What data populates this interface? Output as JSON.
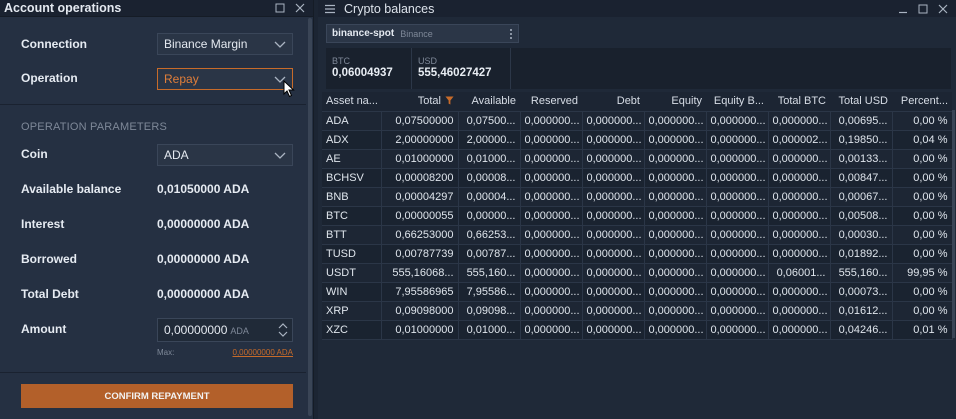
{
  "left_panel": {
    "title": "Account operations",
    "connection_label": "Connection",
    "connection_value": "Binance Margin",
    "operation_label": "Operation",
    "operation_value": "Repay",
    "section_title": "OPERATION PARAMETERS",
    "coin_label": "Coin",
    "coin_value": "ADA",
    "available_label": "Available balance",
    "available_value": "0,01050000 ADA",
    "interest_label": "Interest",
    "interest_value": "0,00000000 ADA",
    "borrowed_label": "Borrowed",
    "borrowed_value": "0,00000000 ADA",
    "total_debt_label": "Total Debt",
    "total_debt_value": "0,00000000 ADA",
    "amount_label": "Amount",
    "amount_value": "0,00000000",
    "amount_unit": "ADA",
    "max_label": "Max:",
    "max_value": "0,00000000 ADA",
    "confirm_label": "CONFIRM REPAYMENT"
  },
  "right_panel": {
    "title": "Crypto balances",
    "account_name": "binance-spot",
    "account_exchange": "Binance",
    "balances": [
      {
        "currency": "BTC",
        "value": "0,06004937"
      },
      {
        "currency": "USD",
        "value": "555,46027427"
      }
    ],
    "columns": [
      "Asset na...",
      "Total",
      "Available",
      "Reserved",
      "Debt",
      "Equity",
      "Equity B...",
      "Total BTC",
      "Total USD",
      "Percent..."
    ],
    "rows": [
      [
        "ADA",
        "0,07500000",
        "0,07500...",
        "0,000000...",
        "0,000000...",
        "0,000000...",
        "0,000000...",
        "0,000000...",
        "0,00695...",
        "0,00 %"
      ],
      [
        "ADX",
        "2,00000000",
        "2,00000...",
        "0,000000...",
        "0,000000...",
        "0,000000...",
        "0,000000...",
        "0,000002...",
        "0,19850...",
        "0,04 %"
      ],
      [
        "AE",
        "0,01000000",
        "0,01000...",
        "0,000000...",
        "0,000000...",
        "0,000000...",
        "0,000000...",
        "0,000000...",
        "0,00133...",
        "0,00 %"
      ],
      [
        "BCHSV",
        "0,00008200",
        "0,00008...",
        "0,000000...",
        "0,000000...",
        "0,000000...",
        "0,000000...",
        "0,000000...",
        "0,00847...",
        "0,00 %"
      ],
      [
        "BNB",
        "0,00004297",
        "0,00004...",
        "0,000000...",
        "0,000000...",
        "0,000000...",
        "0,000000...",
        "0,000000...",
        "0,00067...",
        "0,00 %"
      ],
      [
        "BTC",
        "0,00000055",
        "0,00000...",
        "0,000000...",
        "0,000000...",
        "0,000000...",
        "0,000000...",
        "0,000000...",
        "0,00508...",
        "0,00 %"
      ],
      [
        "BTT",
        "0,66253000",
        "0,66253...",
        "0,000000...",
        "0,000000...",
        "0,000000...",
        "0,000000...",
        "0,000000...",
        "0,00030...",
        "0,00 %"
      ],
      [
        "TUSD",
        "0,00787739",
        "0,00787...",
        "0,000000...",
        "0,000000...",
        "0,000000...",
        "0,000000...",
        "0,000000...",
        "0,01892...",
        "0,00 %"
      ],
      [
        "USDT",
        "555,16068...",
        "555,160...",
        "0,000000...",
        "0,000000...",
        "0,000000...",
        "0,000000...",
        "0,06001...",
        "555,160...",
        "99,95 %"
      ],
      [
        "WIN",
        "7,95586965",
        "7,95586...",
        "0,000000...",
        "0,000000...",
        "0,000000...",
        "0,000000...",
        "0,000000...",
        "0,00073...",
        "0,00 %"
      ],
      [
        "XRP",
        "0,09098000",
        "0,09098...",
        "0,000000...",
        "0,000000...",
        "0,000000...",
        "0,000000...",
        "0,000000...",
        "0,01612...",
        "0,00 %"
      ],
      [
        "XZC",
        "0,01000000",
        "0,01000...",
        "0,000000...",
        "0,000000...",
        "0,000000...",
        "0,000000...",
        "0,000000...",
        "0,04246...",
        "0,01 %"
      ]
    ]
  },
  "colors": {
    "accent": "#c76b2a",
    "button": "#b3602a",
    "panel": "#253042",
    "background": "#1c2533"
  }
}
